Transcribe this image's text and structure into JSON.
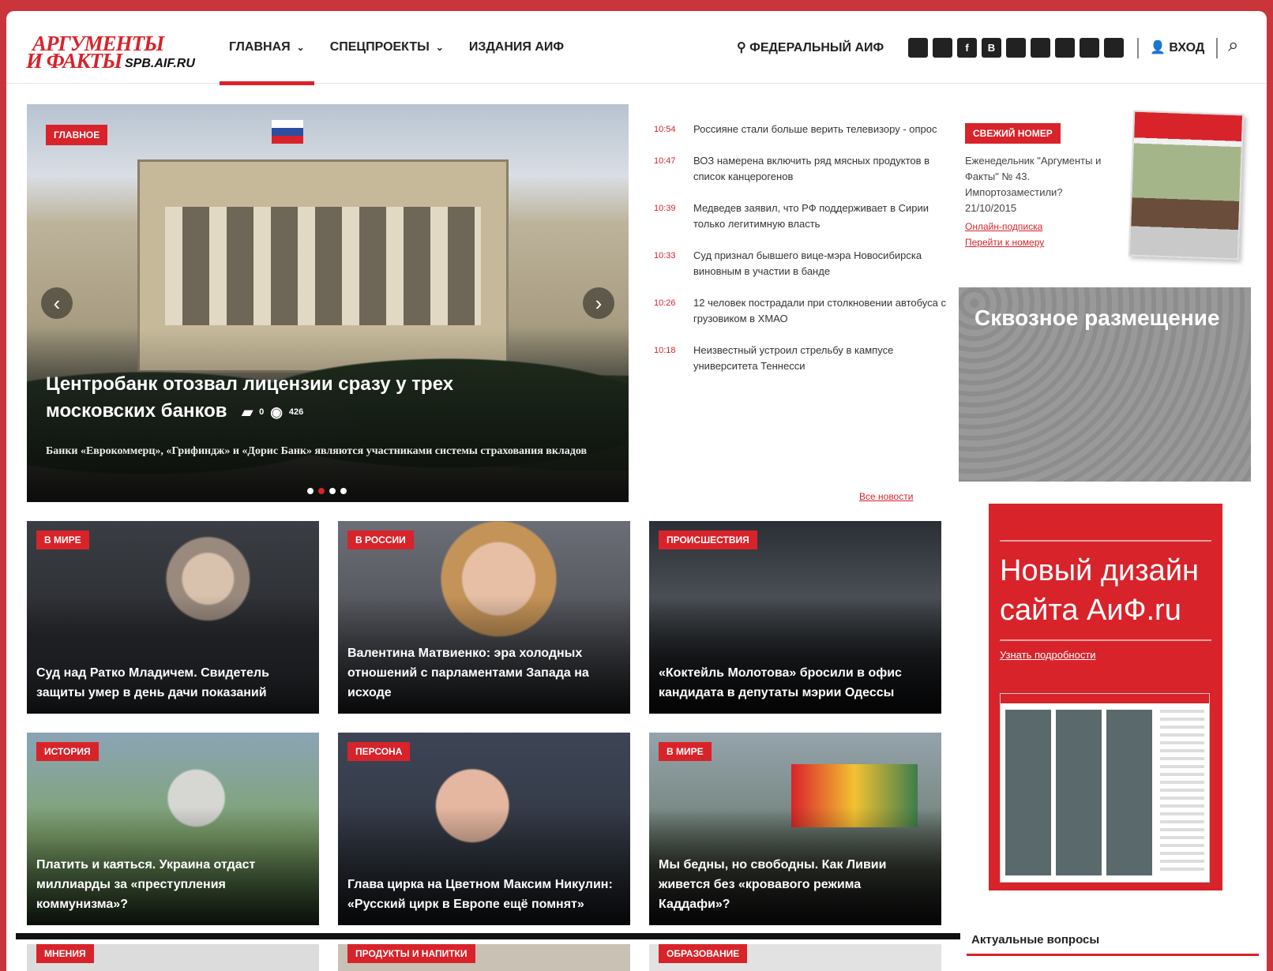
{
  "logo": {
    "line1": "АРГУМЕНТЫ",
    "line2": "И ФАКТЫ",
    "site": "SPB.AIF.RU"
  },
  "nav": [
    {
      "label": "ГЛАВНАЯ"
    },
    {
      "label": "СПЕЦПРОЕКТЫ"
    },
    {
      "label": "ИЗДАНИЯ АИФ"
    }
  ],
  "region": "ФЕДЕРАЛЬНЫЙ АИФ",
  "socials": [
    "",
    "",
    "f",
    "В",
    "",
    "",
    "",
    "",
    ""
  ],
  "login": "ВХОД",
  "hero": {
    "tag": "ГЛАВНОЕ",
    "title": "Центробанк отозвал лицензии сразу у трех московских банков",
    "comments": "0",
    "views": "426",
    "lead": "Банки «Еврокоммерц», «Грифиндж» и «Дорис Банк» являются участниками системы страхования вкладов"
  },
  "news": [
    {
      "time": "10:54",
      "text": "Россияне стали больше верить телевизору - опрос"
    },
    {
      "time": "10:47",
      "text": "ВОЗ намерена включить ряд мясных продуктов в список канцерогенов"
    },
    {
      "time": "10:39",
      "text": "Медведев заявил, что РФ поддерживает в Сирии только легитимную власть"
    },
    {
      "time": "10:33",
      "text": "Суд признал бывшего вице-мэра Новосибирска виновным в участии в банде"
    },
    {
      "time": "10:26",
      "text": "12 человек пострадали при столкновении автобуса с грузовиком в ХМАО"
    },
    {
      "time": "10:18",
      "text": "Неизвестный устроил стрельбу в кампусе университета Теннесси"
    }
  ],
  "all_news": "Все новости",
  "cards": [
    {
      "tag": "В МИРЕ",
      "title": "Суд над Ратко Младичем. Свидетель защиты умер в день дачи показаний"
    },
    {
      "tag": "В РОССИИ",
      "title": "Валентина Матвиенко: эра холодных отношений с парламентами Запада на исходе"
    },
    {
      "tag": "ПРОИСШЕСТВИЯ",
      "title": "«Коктейль Молотова» бросили в офис кандидата в депутаты мэрии Одессы"
    },
    {
      "tag": "ИСТОРИЯ",
      "title": "Платить и каяться. Украина отдаст миллиарды за «преступления коммунизма»?"
    },
    {
      "tag": "ПЕРСОНА",
      "title": "Глава цирка на Цветном Максим Никулин: «Русский цирк в Европе ещё помнят»"
    },
    {
      "tag": "В МИРЕ",
      "title": "Мы бедны, но свободны. Как Ливии живется без «кровавого режима Каддафи»?"
    }
  ],
  "row3_tags": [
    "МНЕНИЯ",
    "ПРОДУКТЫ И НАПИТКИ",
    "ОБРАЗОВАНИЕ"
  ],
  "issue": {
    "tag": "СВЕЖИЙ НОМЕР",
    "text": "Еженедельник \"Аргументы и Факты\" № 43. Импортозаместили? 21/10/2015",
    "link1": "Онлайн-подписка",
    "link2": "Перейти к номеру"
  },
  "ad_gray": "Сквозное размещение",
  "ad_red": {
    "title": "Новый дизайн сайта АиФ.ru",
    "more": "Узнать подробности"
  },
  "faq_title": "Актуальные вопросы"
}
